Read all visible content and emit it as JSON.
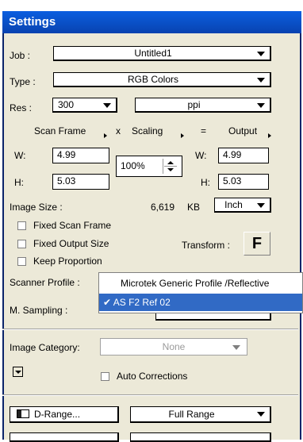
{
  "window": {
    "title": "Settings"
  },
  "job": {
    "label": "Job :",
    "value": "Untitled1"
  },
  "type": {
    "label": "Type :",
    "value": "RGB Colors"
  },
  "res": {
    "label": "Res :",
    "value": "300",
    "unit": "ppi"
  },
  "headers": {
    "scan_frame": "Scan Frame",
    "x": "x",
    "scaling": "Scaling",
    "eq": "=",
    "output": "Output"
  },
  "scan": {
    "w_label": "W:",
    "w": "4.99",
    "h_label": "H:",
    "h": "5.03"
  },
  "scaling": {
    "value": "100%"
  },
  "output": {
    "w_label": "W:",
    "w": "4.99",
    "h_label": "H:",
    "h": "5.03"
  },
  "image_size": {
    "label": "Image Size :",
    "value": "6,619",
    "unit": "KB",
    "size_unit": "Inch"
  },
  "options": {
    "fixed_scan_frame": "Fixed Scan Frame",
    "fixed_output_size": "Fixed Output Size",
    "keep_proportion": "Keep Proportion",
    "transform_label": "Transform :",
    "transform_btn": "F"
  },
  "scanner_profile": {
    "label": "Scanner Profile :",
    "options": [
      "Microtek Generic Profile /Reflective",
      "AS F2 Ref 02"
    ],
    "selected_index": 1
  },
  "m_sampling": {
    "label": "M. Sampling :"
  },
  "image_category": {
    "label": "Image Category:",
    "value": "None"
  },
  "auto_corrections": {
    "label": "Auto Corrections"
  },
  "drange": {
    "button": "D-Range...",
    "value": "Full Range"
  },
  "colors": {
    "accent": "#0b5fe0",
    "panel": "#ece9d8",
    "highlight": "#316ac5"
  }
}
